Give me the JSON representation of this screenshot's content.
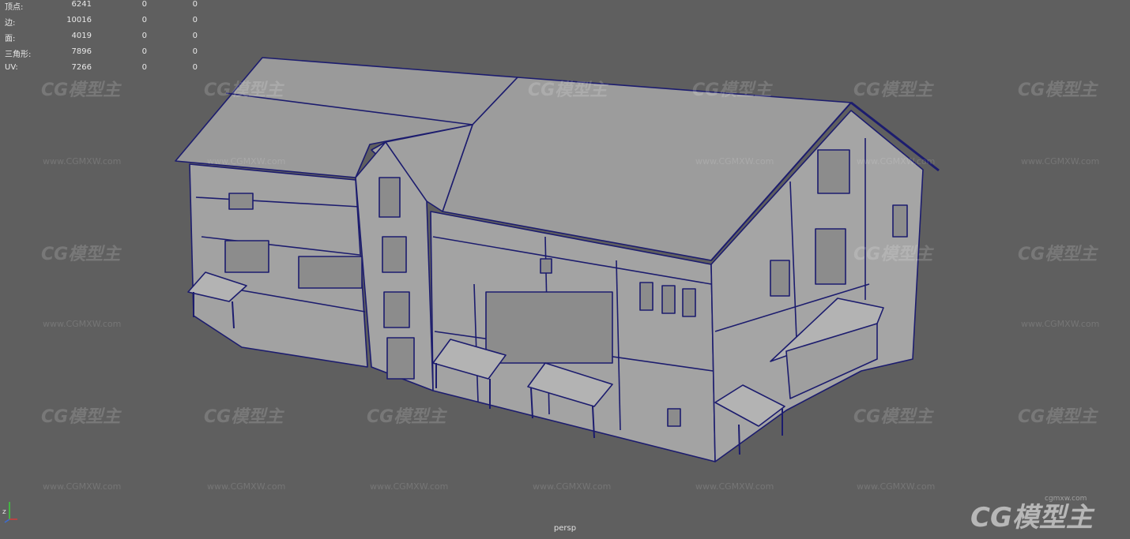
{
  "viewport": {
    "camera": "persp",
    "background": "#5f5f5f",
    "wire_color": "#1c1c6e",
    "surface_color": "#9a9a9a"
  },
  "hud": {
    "rows": [
      {
        "label": "顶点:",
        "v1": "6241",
        "v2": "0",
        "v3": "0"
      },
      {
        "label": "边:",
        "v1": "10016",
        "v2": "0",
        "v3": "0"
      },
      {
        "label": "面:",
        "v1": "4019",
        "v2": "0",
        "v3": "0"
      },
      {
        "label": "三角形:",
        "v1": "7896",
        "v2": "0",
        "v3": "0"
      },
      {
        "label": "UV:",
        "v1": "7266",
        "v2": "0",
        "v3": "0"
      }
    ]
  },
  "watermark": {
    "logo_text": "CG模型主",
    "url_text": "www.CGMXW.com",
    "corner_logo": "CG模型主",
    "corner_url": "cgmxw.com"
  },
  "axis": {
    "label": "z",
    "icon": "axis-gizmo-icon"
  }
}
